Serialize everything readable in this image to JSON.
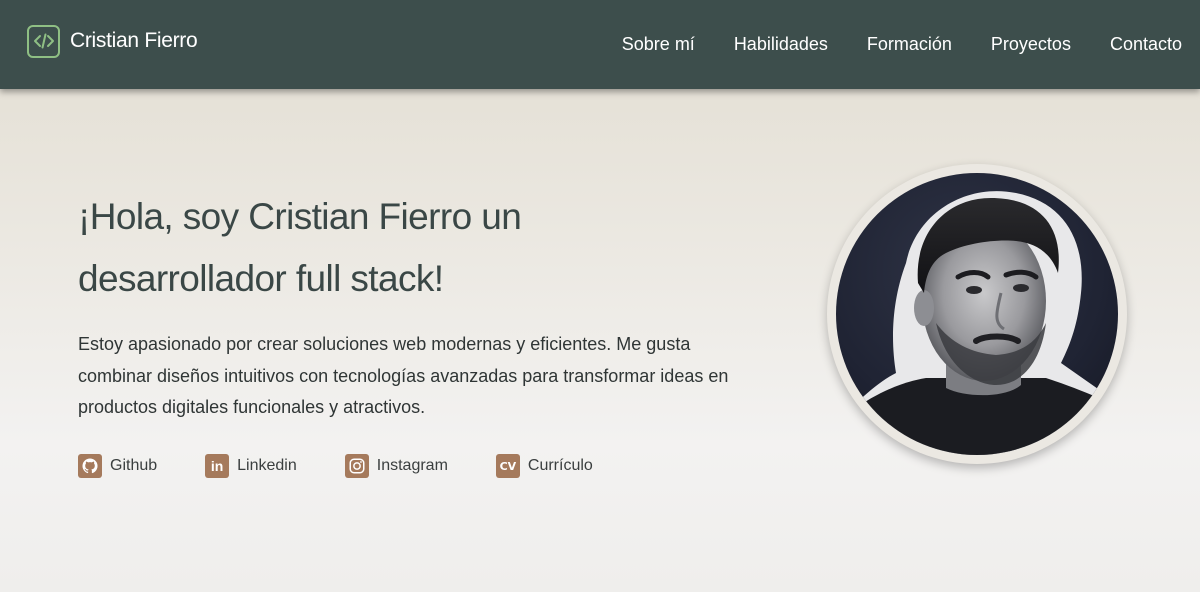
{
  "header": {
    "brand_name": "Cristian Fierro",
    "brand_icon": "code-icon",
    "nav": [
      {
        "label": "Sobre mí"
      },
      {
        "label": "Habilidades"
      },
      {
        "label": "Formación"
      },
      {
        "label": "Proyectos"
      },
      {
        "label": "Contacto"
      }
    ]
  },
  "hero": {
    "title_line1": "¡Hola, soy Cristian Fierro un",
    "title_line2": "desarrollador full stack!",
    "description": "Estoy apasionado por crear soluciones web modernas y eficientes. Me gusta combinar diseños intuitivos con tecnologías avanzadas para transformar ideas en productos digitales funcionales y atractivos.",
    "socials": [
      {
        "label": "Github",
        "icon": "github-icon"
      },
      {
        "label": "Linkedin",
        "icon": "linkedin-icon",
        "glyph": "in"
      },
      {
        "label": "Instagram",
        "icon": "instagram-icon"
      },
      {
        "label": "Currículo",
        "icon": "cv-icon",
        "glyph": "CV"
      }
    ]
  },
  "colors": {
    "header_bg": "#3d4e4c",
    "brand_accent": "#8fbf84",
    "social_icon_bg": "#a57a5c",
    "title_color": "#3a4746"
  }
}
